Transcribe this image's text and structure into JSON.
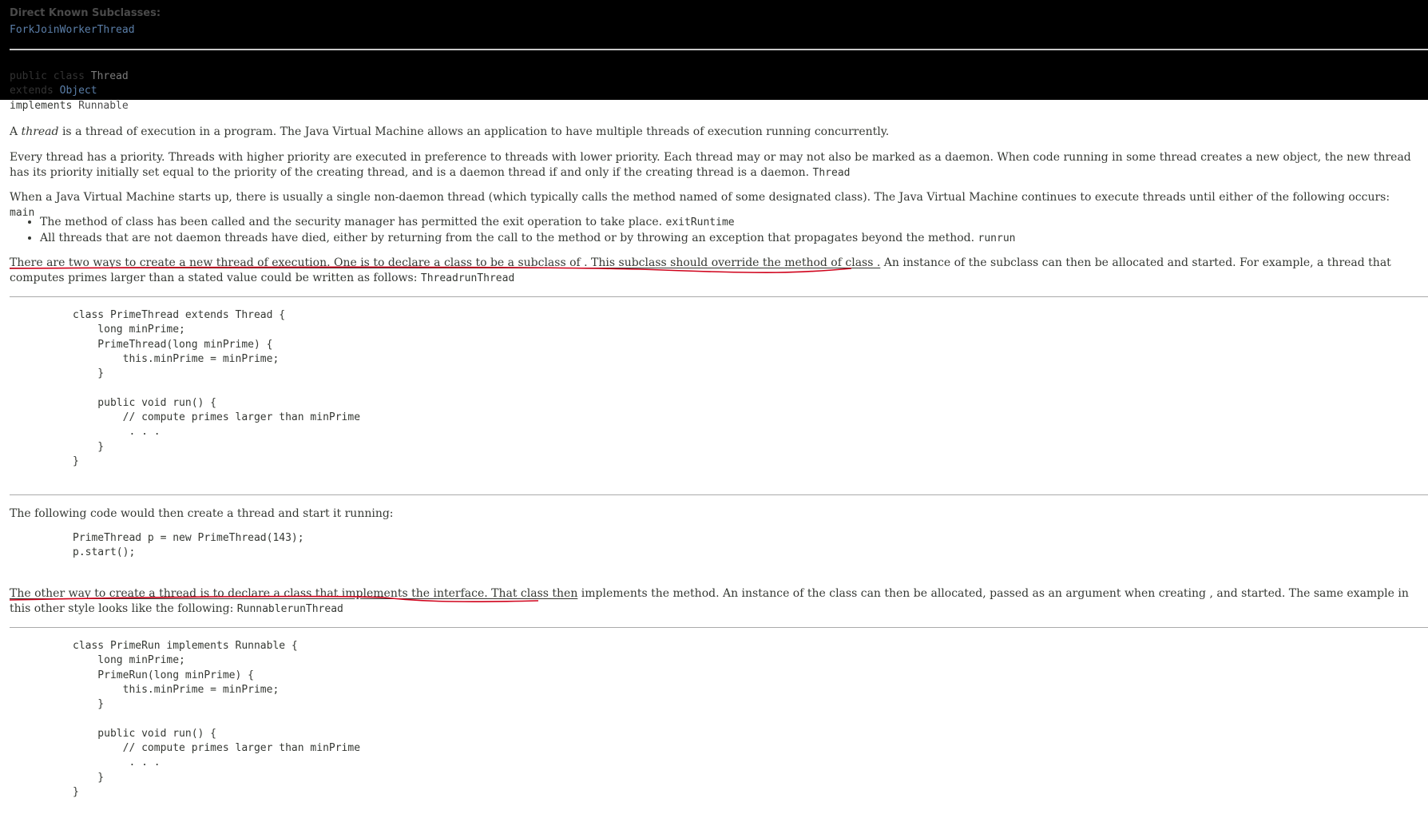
{
  "header": {
    "subclasses_label": "Direct Known Subclasses:",
    "subclass_link": "ForkJoinWorkerThread",
    "decl_public_class": "public class ",
    "decl_class_name": "Thread",
    "decl_extends": "extends ",
    "decl_object": "Object",
    "decl_implements": "implements ",
    "decl_runnable": "Runnable"
  },
  "paragraphs": {
    "p1_pre": "A ",
    "p1_em": "thread",
    "p1_post": " is a thread of execution in a program. The Java Virtual Machine allows an application to have multiple threads of execution running concurrently.",
    "p2_text": "Every thread has a priority. Threads with higher priority are executed in preference to threads with lower priority. Each thread may or may not also be marked as a daemon. When code running in some thread creates a new object, the new thread has its priority initially set equal to the priority of the creating thread, and is a daemon thread if and only if the creating thread is a daemon. ",
    "p2_code": "Thread",
    "p3_text": "When a Java Virtual Machine starts up, there is usually a single non-daemon thread (which typically calls the method named of some designated class). The Java Virtual Machine continues to execute threads until either of the following occurs: ",
    "p3_code": "main",
    "bullet1_text": "The method of class has been called and the security manager has permitted the exit operation to take place. ",
    "bullet1_code": "exitRuntime",
    "bullet2_text": "All threads that are not daemon threads have died, either by returning from the call to the method or by throwing an exception that propagates beyond the method. ",
    "bullet2_code": "runrun",
    "p4_underlined": "There are two ways to create a new thread of execution. One is to declare a class to be a subclass of . This subclass should override the method of class .",
    "p4_rest": " An instance of the subclass can then be allocated and started. For example, a thread that computes primes larger than a stated value could be written as follows: ",
    "p4_code": "ThreadrunThread",
    "p5_text": "The following code would then create a thread and start it running:",
    "p6_underlined": "The other way to create a thread is to declare a class that implements the interface. That class then",
    "p6_rest": " implements the method. An instance of the class can then be allocated, passed as an argument when creating , and started. The same example in this other style looks like the following: ",
    "p6_code": "RunnablerunThread"
  },
  "code_blocks": {
    "prime_thread": "class PrimeThread extends Thread {\n    long minPrime;\n    PrimeThread(long minPrime) {\n        this.minPrime = minPrime;\n    }\n\n    public void run() {\n        // compute primes larger than minPrime\n         . . .\n    }\n}",
    "start_thread": "PrimeThread p = new PrimeThread(143);\np.start();",
    "prime_run": "class PrimeRun implements Runnable {\n    long minPrime;\n    PrimeRun(long minPrime) {\n        this.minPrime = minPrime;\n    }\n\n    public void run() {\n        // compute primes larger than minPrime\n         . . .\n    }\n}"
  },
  "colors": {
    "link": "#5a7ea8",
    "annotation": "#d0021b",
    "header_bg": "#000000"
  }
}
